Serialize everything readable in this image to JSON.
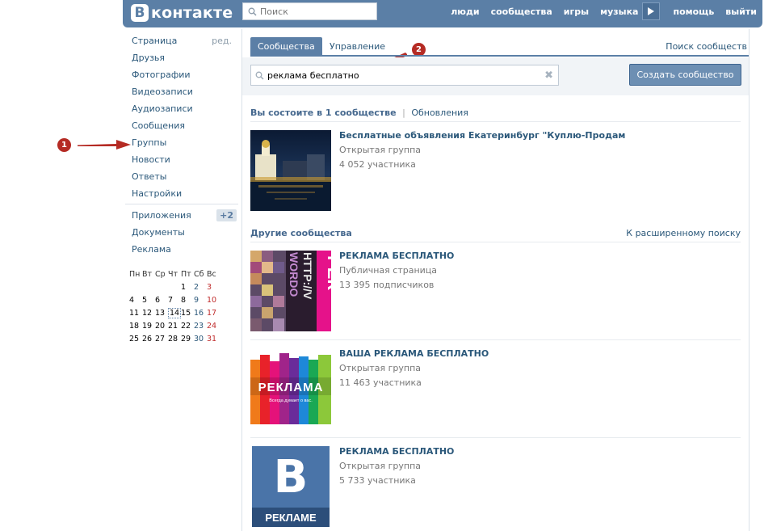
{
  "header": {
    "logo_letter": "В",
    "logo_text": "контакте",
    "search_placeholder": "Поиск",
    "nav": [
      "люди",
      "сообщества",
      "игры",
      "музыка",
      "помощь",
      "выйти"
    ]
  },
  "menu": {
    "edit_label": "ред.",
    "items": [
      "Страница",
      "Друзья",
      "Фотографии",
      "Видеозаписи",
      "Аудиозаписи",
      "Сообщения",
      "Группы",
      "Новости",
      "Ответы",
      "Настройки"
    ],
    "extra": [
      "Приложения",
      "Документы",
      "Реклама"
    ],
    "apps_badge": "+2"
  },
  "calendar": {
    "weekdays": [
      "Пн",
      "Вт",
      "Ср",
      "Чт",
      "Пт",
      "Сб",
      "Вс"
    ],
    "weeks": [
      [
        "",
        "",
        "",
        "",
        "1",
        "2",
        "3"
      ],
      [
        "4",
        "5",
        "6",
        "7",
        "8",
        "9",
        "10"
      ],
      [
        "11",
        "12",
        "13",
        "14",
        "15",
        "16",
        "17"
      ],
      [
        "18",
        "19",
        "20",
        "21",
        "22",
        "23",
        "24"
      ],
      [
        "25",
        "26",
        "27",
        "28",
        "29",
        "30",
        "31"
      ]
    ],
    "today": "14"
  },
  "markers": {
    "first": "1",
    "second": "2"
  },
  "tabs": {
    "active": "Сообщества",
    "manage": "Управление",
    "search_link": "Поиск сообществ"
  },
  "search": {
    "value": "реклама бесплатно",
    "clear_glyph": "✖"
  },
  "create_button": "Создать сообщество",
  "member_section": {
    "title": "Вы состоите в 1 сообществе",
    "separator": "|",
    "updates": "Обновления"
  },
  "my_groups": [
    {
      "name": "Бесплатные объявления Екатеринбург \"Куплю-Продам",
      "type": "Открытая группа",
      "count": "4 052 участника"
    }
  ],
  "other_section": {
    "title": "Другие сообщества",
    "advanced_link": "К расширенному поиску"
  },
  "other_groups": [
    {
      "name": "РЕКЛАМА БЕСПЛАТНО",
      "type": "Публичная страница",
      "count": "13 395 подписчиков",
      "thumb_text": "РЕК",
      "thumb_text2": "HTTP://V",
      "thumb_text3": "WORDO"
    },
    {
      "name": "ВАША РЕКЛАМА БЕСПЛАТНО",
      "type": "Открытая группа",
      "count": "11 463 участника",
      "thumb_text": "РЕКЛАМА",
      "thumb_text2": "Всегда думает о вас."
    },
    {
      "name": "РЕКЛАМА БЕСПЛАТНО",
      "type": "Открытая группа",
      "count": "5 733 участника",
      "thumb_text": "В",
      "thumb_text2": "РЕКЛАМЕ"
    }
  ]
}
